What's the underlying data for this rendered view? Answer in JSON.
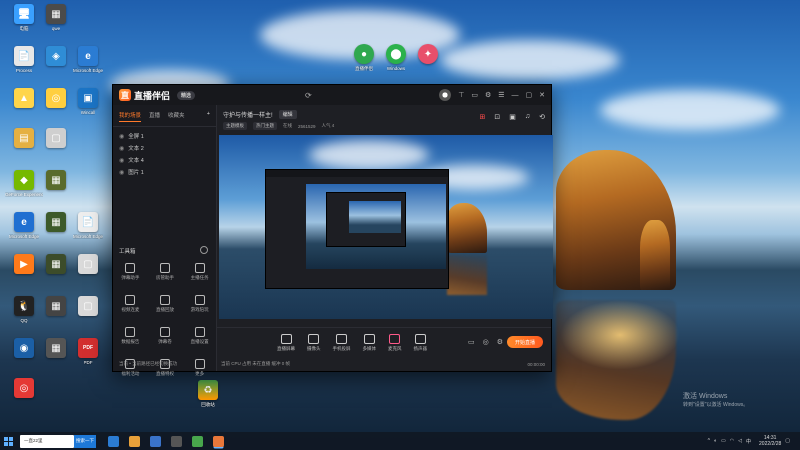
{
  "desktop": {
    "icons_left": [
      {
        "label": "电脑",
        "color": "#3aa0ff",
        "glyph": "🖥"
      },
      {
        "label": "qwe",
        "color": "#4b4b4b",
        "glyph": "▦"
      },
      {
        "label": "Microsoft Edge",
        "color": "#2b7cd3",
        "glyph": "e"
      },
      {
        "label": "Process",
        "color": "#e7e7e7",
        "glyph": "📄"
      },
      {
        "label": "",
        "color": "#2f8dd6",
        "glyph": "◈"
      },
      {
        "label": "",
        "color": "#ffd54a",
        "glyph": "▲"
      },
      {
        "label": "",
        "color": "#ffcf40",
        "glyph": "◎"
      },
      {
        "label": "Wincall",
        "color": "#1b74c5",
        "glyph": "▣"
      },
      {
        "label": "",
        "color": "#e5b042",
        "glyph": "▤"
      },
      {
        "label": "",
        "color": "#cfcfcf",
        "glyph": "▢"
      },
      {
        "label": "GeForce Experience",
        "color": "#76b900",
        "glyph": "◆"
      },
      {
        "label": "",
        "color": "#5a6b2c",
        "glyph": "▦"
      },
      {
        "label": "Microsoft Edge",
        "color": "#1f6fd1",
        "glyph": "e"
      },
      {
        "label": "",
        "color": "#3d5a2a",
        "glyph": "▦"
      },
      {
        "label": "Microsoft Edge",
        "color": "#eeeeee",
        "glyph": "📄"
      },
      {
        "label": "",
        "color": "#ff7a1a",
        "glyph": "▶"
      },
      {
        "label": "",
        "color": "#3c4c2a",
        "glyph": "▦"
      },
      {
        "label": "",
        "color": "#dadada",
        "glyph": "▢"
      },
      {
        "label": "QQ",
        "color": "#222222",
        "glyph": "🐧"
      },
      {
        "label": "",
        "color": "#444444",
        "glyph": "▦"
      },
      {
        "label": "",
        "color": "#dadada",
        "glyph": "▢"
      },
      {
        "label": "",
        "color": "#1b5fa6",
        "glyph": "◉"
      },
      {
        "label": "",
        "color": "#555555",
        "glyph": "▦"
      },
      {
        "label": "PDF",
        "color": "#d32f2f",
        "glyph": "PDF"
      },
      {
        "label": "",
        "color": "#e53935",
        "glyph": "◎"
      }
    ],
    "icons_top": [
      {
        "label": "直播伴侣",
        "color": "#2fa84f",
        "glyph": "●"
      },
      {
        "label": "Windows",
        "color": "#2bb24c",
        "glyph": "⬤"
      },
      {
        "label": "",
        "color": "#e84f6b",
        "glyph": "✦"
      }
    ],
    "recycle_label": "回收站",
    "watermark_title": "激活 Windows",
    "watermark_sub": "转到\"设置\"以激活 Windows。"
  },
  "app": {
    "name": "直播伴侣",
    "version": "精选",
    "sidebar_tabs": [
      "我的场景",
      "直播",
      "收藏夹"
    ],
    "sources": [
      "全屏 1",
      "文本 2",
      "文本 4",
      "图片 1"
    ],
    "tools_title": "工具箱",
    "tools": [
      "弹幕助手",
      "房管助手",
      "主播任务",
      "视频连麦",
      "直播回放",
      "游戏陪玩",
      "数据报告",
      "弹幕卷",
      "直播设置",
      "福利活动",
      "直播特权",
      "更多"
    ],
    "room_title": "守护与传播一样主!",
    "room_edit": "编辑",
    "room_tags": [
      "主题模板",
      "热门主题"
    ],
    "room_stats": [
      "在线",
      "2561529",
      "人气 4"
    ],
    "bottom_controls": [
      "直播屏幕",
      "摄像头",
      "手机投屏",
      "多媒体",
      "麦克风",
      "扬声器"
    ],
    "live_button": "开始直播",
    "bottom_stats": "当前 CPU 占用 未在直播 缓冲 0 帧",
    "timer": "00:00:00",
    "status_left": "当前 • 当前路径已经切换成功"
  },
  "taskbar": {
    "search_text": "一直22里",
    "search_button": "搜索一下",
    "time": "14:31",
    "date": "2022/2/28",
    "apps": [
      {
        "color": "#2b7cd3"
      },
      {
        "color": "#e8a13a"
      },
      {
        "color": "#3a73c9"
      },
      {
        "color": "#555555"
      },
      {
        "color": "#48a64c"
      },
      {
        "color": "#e8773a"
      }
    ]
  }
}
